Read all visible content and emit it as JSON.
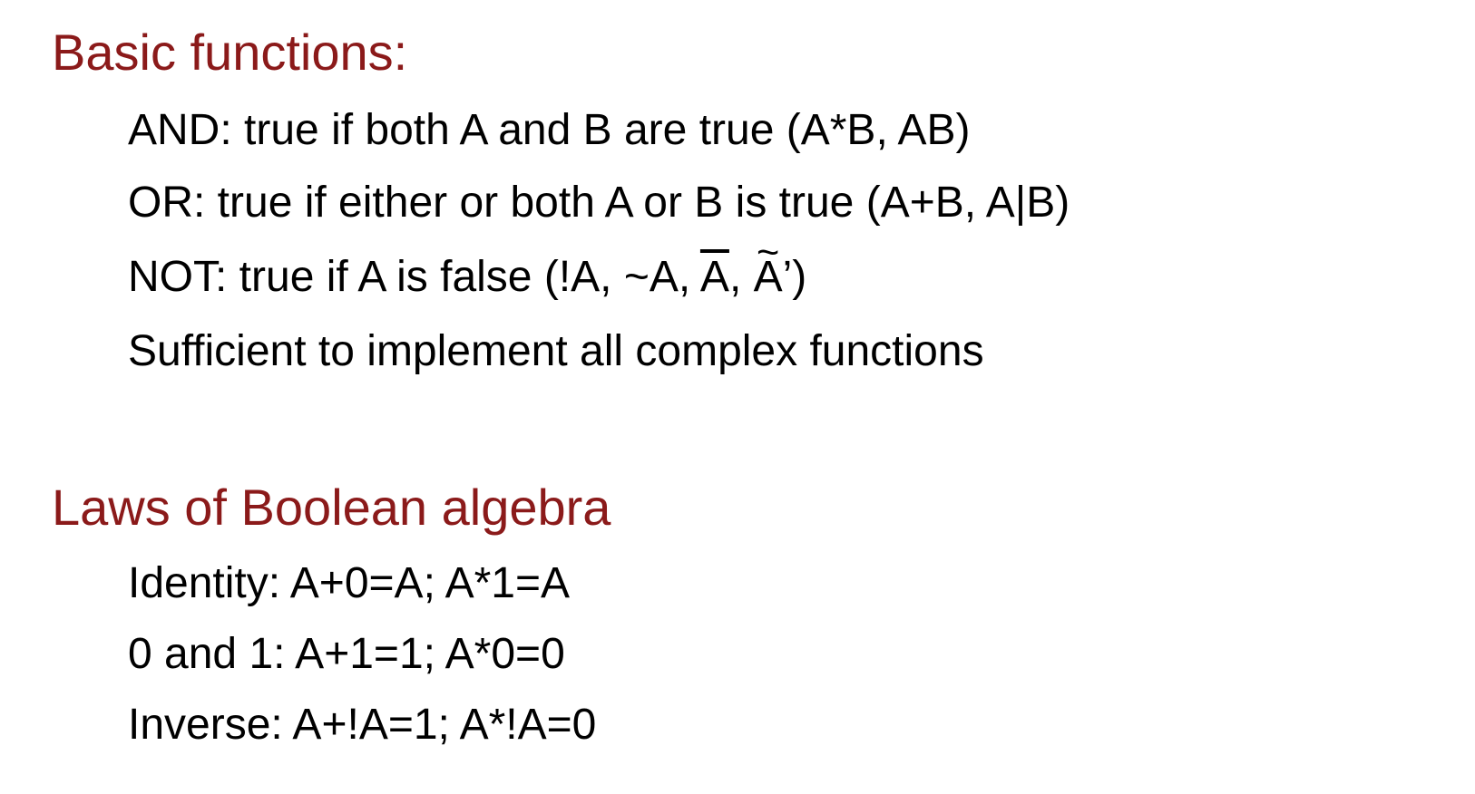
{
  "section1": {
    "heading": "Basic functions:",
    "items": [
      "AND: true if both A and B are true (A*B, AB)",
      "OR: true if either or both A or B is true (A+B, A|B)",
      "Sufficient to implement all complex functions"
    ],
    "not_item": {
      "prefix": "NOT: true if A is false (!A, ~A, ",
      "bar_a": "A",
      "sep": ", ",
      "tilde_a": "A",
      "suffix": "’)"
    }
  },
  "section2": {
    "heading": "Laws of Boolean algebra",
    "items": [
      "Identity: A+0=A; A*1=A",
      "0 and 1: A+1=1; A*0=0",
      "Inverse: A+!A=1; A*!A=0"
    ]
  },
  "colors": {
    "heading": "#8b1a1a",
    "body_text": "#000000",
    "background": "#ffffff"
  }
}
